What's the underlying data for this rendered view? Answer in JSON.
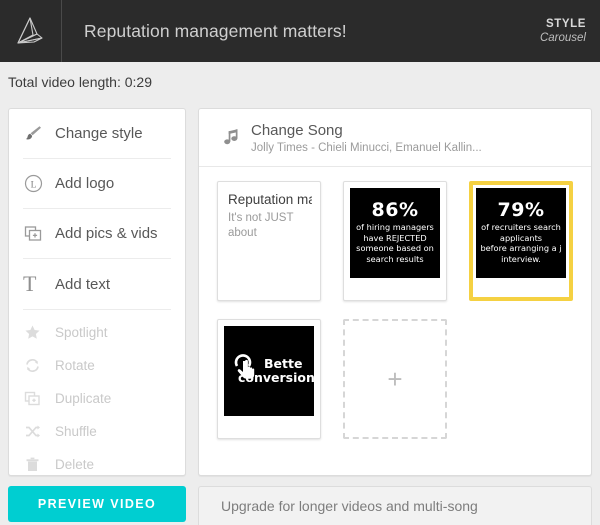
{
  "header": {
    "logo_icon": "animoto-fan-logo-icon",
    "title": "Reputation management matters!",
    "style_label": "STYLE",
    "style_value": "Carousel"
  },
  "length_bar": {
    "text": "Total video length: 0:29"
  },
  "sidebar": {
    "items": [
      {
        "label": "Change style",
        "icon": "paintbrush-icon",
        "enabled": true
      },
      {
        "label": "Add logo",
        "icon": "circled-l-icon",
        "enabled": true
      },
      {
        "label": "Add pics & vids",
        "icon": "add-media-icon",
        "enabled": true
      },
      {
        "label": "Add text",
        "icon": "text-t-icon",
        "enabled": true
      },
      {
        "label": "Spotlight",
        "icon": "star-icon",
        "enabled": false
      },
      {
        "label": "Rotate",
        "icon": "rotate-icon",
        "enabled": false
      },
      {
        "label": "Duplicate",
        "icon": "duplicate-icon",
        "enabled": false
      },
      {
        "label": "Shuffle",
        "icon": "shuffle-icon",
        "enabled": false
      },
      {
        "label": "Delete",
        "icon": "trash-icon",
        "enabled": false
      }
    ],
    "preview_button": "PREVIEW VIDEO"
  },
  "main": {
    "song": {
      "icon": "music-note-icon",
      "title": "Change Song",
      "subtitle": "Jolly Times - Chieli Minucci, Emanuel Kallin..."
    },
    "cards": [
      {
        "type": "text",
        "heading": "Reputation managemer",
        "subtext": "It's not JUST\nabout",
        "selected": false
      },
      {
        "type": "photo",
        "percent": "86%",
        "lines": "of hiring managers\nhave REJECTED\nsomeone based on\nsearch results",
        "selected": false
      },
      {
        "type": "photo",
        "percent": "79%",
        "lines": "of recruiters search\napplicants\nbefore arranging a j\ninterview.",
        "selected": true
      },
      {
        "type": "photo-icon",
        "icon": "tap-hand-icon",
        "words_line1": "Bette",
        "words_line2": "conversion",
        "selected": false
      },
      {
        "type": "add-slot",
        "icon": "plus-icon"
      }
    ]
  },
  "upgrade_bar": {
    "text": "Upgrade for longer videos and multi-song"
  },
  "colors": {
    "topbar": "#2b2b2b",
    "page_background": "#ededed",
    "accent_teal": "#00ced1",
    "selection_yellow": "#f5d142",
    "panel_white": "#ffffff"
  }
}
